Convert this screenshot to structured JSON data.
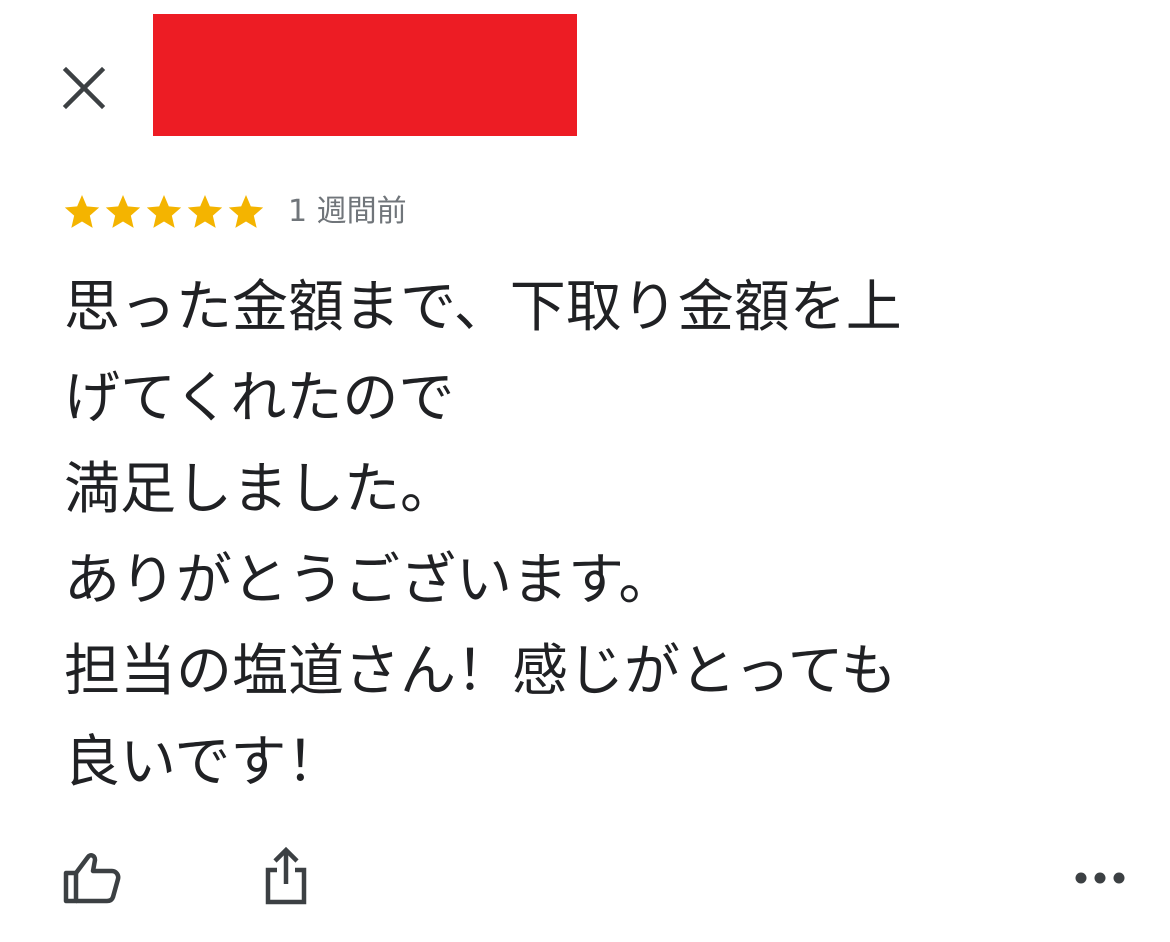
{
  "header": {
    "close_icon": "close-icon",
    "redaction_color": "#ed1c24"
  },
  "review": {
    "rating": 5,
    "max_rating": 5,
    "star_color": "#f4b400",
    "time_ago": "1 週間前",
    "text": "思った金額まで、下取り金額を上\nげてくれたので\n満足しました。\nありがとうございます。\n担当の塩道さん！感じがとっても\n良いです！"
  },
  "actions": {
    "like_icon": "thumbs-up-icon",
    "share_icon": "share-icon",
    "more_icon": "more-options-icon"
  }
}
